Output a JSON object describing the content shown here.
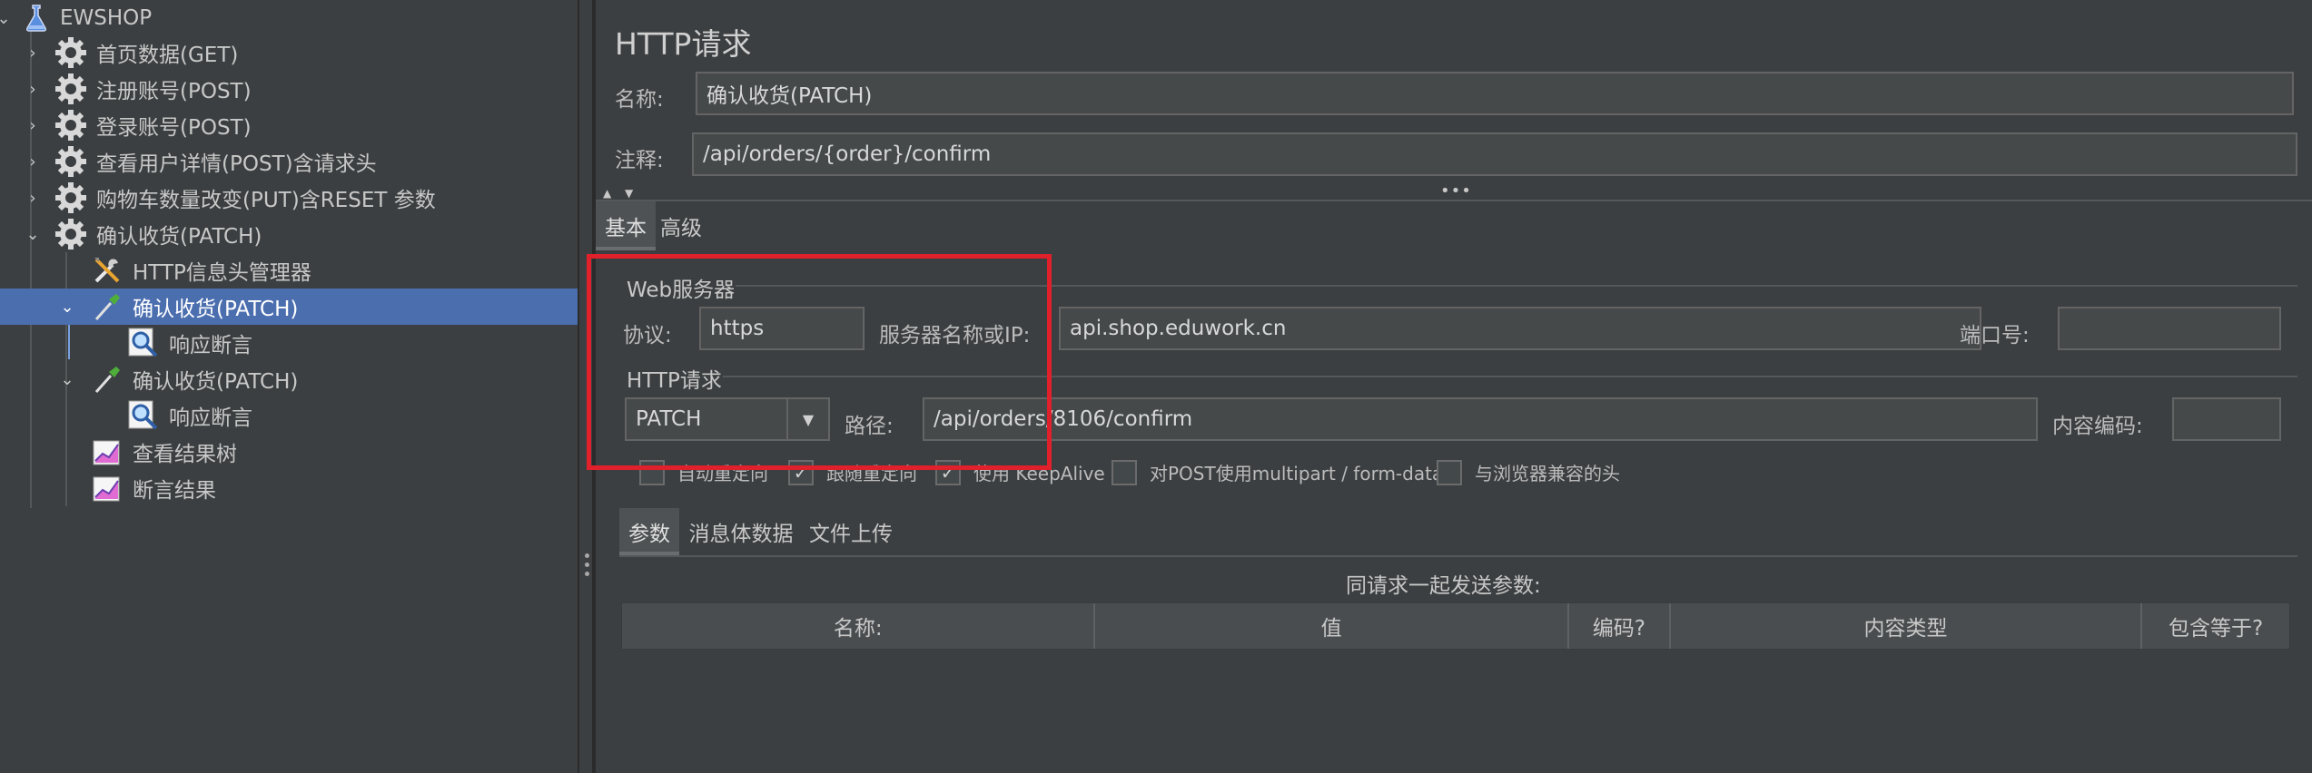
{
  "tree": {
    "items": [
      {
        "label": "EWSHOP",
        "icon": "flask-icon",
        "expanded": true
      },
      {
        "label": "首页数据(GET)",
        "icon": "gear-icon",
        "expanded": false
      },
      {
        "label": "注册账号(POST)",
        "icon": "gear-icon",
        "expanded": false
      },
      {
        "label": "登录账号(POST)",
        "icon": "gear-icon",
        "expanded": false
      },
      {
        "label": "查看用户详情(POST)含请求头",
        "icon": "gear-icon",
        "expanded": false
      },
      {
        "label": "购物车数量改变(PUT)含RESET 参数",
        "icon": "gear-icon",
        "expanded": false
      },
      {
        "label": "确认收货(PATCH)",
        "icon": "gear-icon",
        "expanded": true
      },
      {
        "label": "HTTP信息头管理器",
        "icon": "wrench-icon"
      },
      {
        "label": "确认收货(PATCH)",
        "icon": "pipette-icon",
        "expanded": true,
        "selected": true
      },
      {
        "label": "响应断言",
        "icon": "magnifier-icon"
      },
      {
        "label": "确认收货(PATCH)",
        "icon": "pipette-icon",
        "expanded": true
      },
      {
        "label": "响应断言",
        "icon": "magnifier-icon"
      },
      {
        "label": "查看结果树",
        "icon": "graph-icon"
      },
      {
        "label": "断言结果",
        "icon": "graph-icon"
      }
    ]
  },
  "panel": {
    "title": "HTTP请求",
    "name_label": "名称:",
    "name_value": "确认收货(PATCH)",
    "comment_label": "注释:",
    "comment_value": "/api/orders/{order}/confirm",
    "tabs": [
      "基本",
      "高级"
    ],
    "web_server": {
      "group_title": "Web服务器",
      "protocol_label": "协议:",
      "protocol_value": "https",
      "server_label": "服务器名称或IP:",
      "server_value": "api.shop.eduwork.cn",
      "port_label": "端口号:",
      "port_value": ""
    },
    "http_request": {
      "group_title": "HTTP请求",
      "method": "PATCH",
      "path_label": "路径:",
      "path_value": "/api/orders/8106/confirm",
      "encoding_label": "内容编码:",
      "encoding_value": ""
    },
    "checkboxes": [
      {
        "label": "自动重定向",
        "checked": false
      },
      {
        "label": "跟随重定向",
        "checked": true
      },
      {
        "label": "使用 KeepAlive",
        "checked": true
      },
      {
        "label": "对POST使用multipart / form-data",
        "checked": false
      },
      {
        "label": "与浏览器兼容的头",
        "checked": false
      }
    ],
    "sub_tabs": [
      "参数",
      "消息体数据",
      "文件上传"
    ],
    "params_caption": "同请求一起发送参数:",
    "table_headers": [
      "名称:",
      "值",
      "编码?",
      "内容类型",
      "包含等于?"
    ]
  },
  "colors": {
    "background": "#3c3f41",
    "selection": "#4b6eaf",
    "highlight_box": "#e0202a"
  }
}
